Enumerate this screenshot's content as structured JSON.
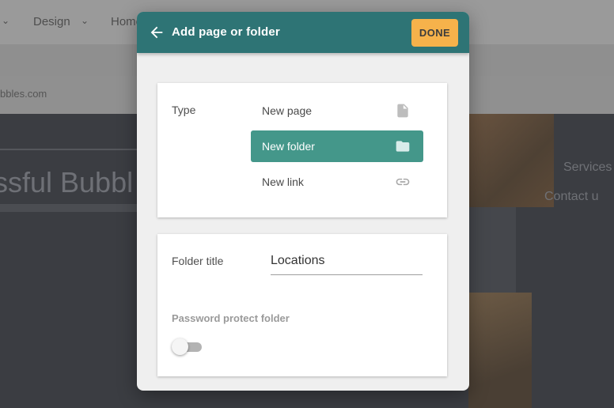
{
  "background": {
    "menu_design": "Design",
    "menu_home": "Home",
    "url_fragment": "bbles.com",
    "site_title": "ssful Bubbl",
    "nav_services": "Services",
    "nav_contact": "Contact u"
  },
  "dialog": {
    "title": "Add page or folder",
    "done_label": "DONE",
    "back_icon": "arrow-left-icon",
    "header_color": "#2e7475",
    "done_color": "#f6b24b"
  },
  "type_section": {
    "label": "Type",
    "selected_color": "#44978a",
    "options": [
      {
        "label": "New page",
        "icon": "file-icon",
        "selected": false
      },
      {
        "label": "New folder",
        "icon": "folder-icon",
        "selected": true
      },
      {
        "label": "New link",
        "icon": "link-icon",
        "selected": false
      }
    ]
  },
  "folder_section": {
    "title_label": "Folder title",
    "title_value": "Locations",
    "password_label": "Password protect folder",
    "password_enabled": false
  }
}
